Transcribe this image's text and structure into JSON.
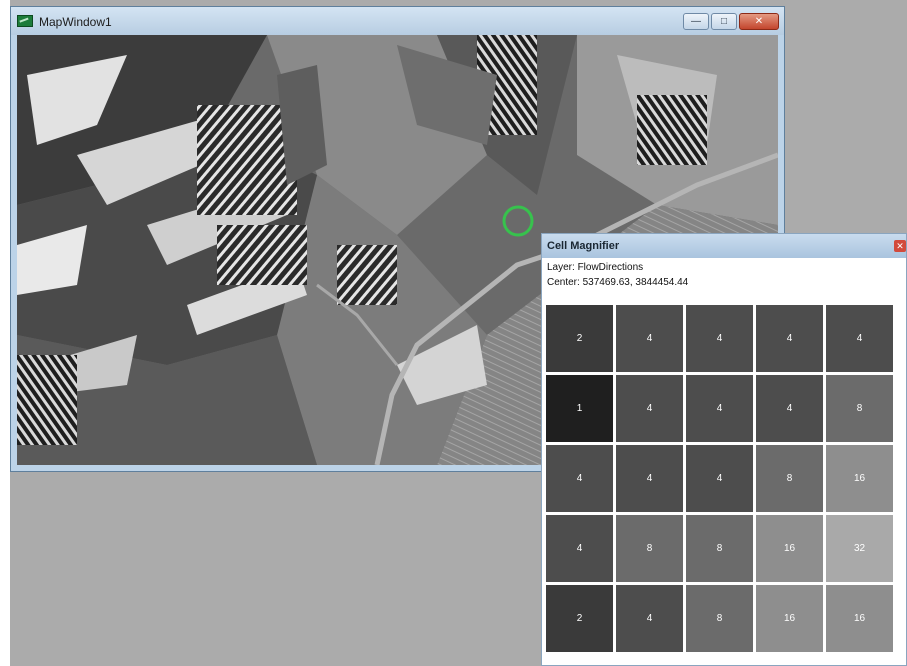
{
  "map_window": {
    "title": "MapWindow1",
    "icon": "map-app-icon",
    "buttons": {
      "minimize": "—",
      "maximize": "□",
      "close": "✕"
    }
  },
  "magnifier": {
    "title": "Cell Magnifier",
    "close_label": "✕",
    "layer_line": "Layer: FlowDirections",
    "center_line": "Center: 537469.63, 3844454.44",
    "cells": [
      [
        "2",
        "4",
        "4",
        "4",
        "4"
      ],
      [
        "1",
        "4",
        "4",
        "4",
        "8"
      ],
      [
        "4",
        "4",
        "4",
        "8",
        "16"
      ],
      [
        "4",
        "8",
        "8",
        "16",
        "32"
      ],
      [
        "2",
        "4",
        "8",
        "16",
        "16"
      ]
    ],
    "cell_colors": {
      "1": "#1f1f1f",
      "2": "#3a3a3a",
      "4": "#4d4d4d",
      "8": "#6b6b6b",
      "16": "#8e8e8e",
      "32": "#a9a9a9"
    }
  }
}
